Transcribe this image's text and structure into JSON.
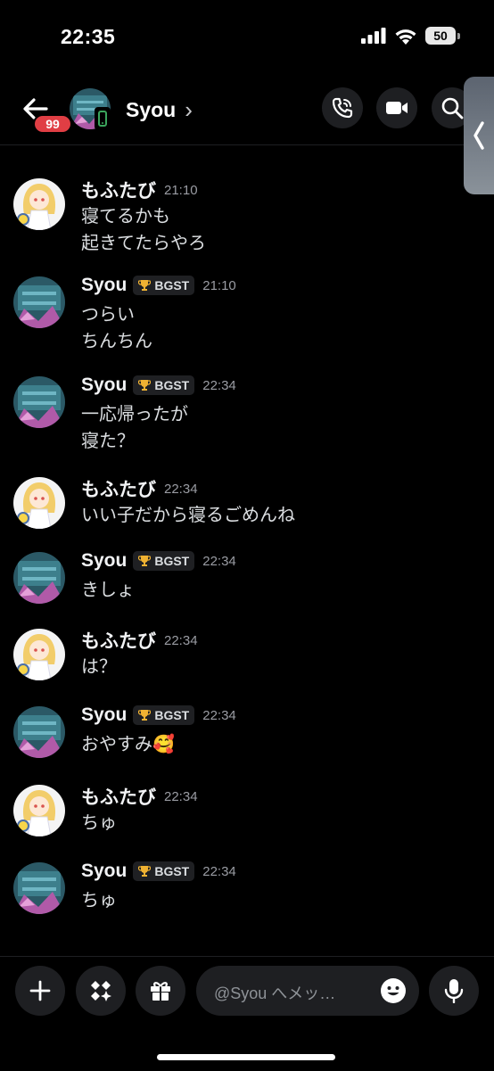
{
  "status_bar": {
    "time": "22:35",
    "battery": "50"
  },
  "header": {
    "unread_count": "99",
    "title": "Syou",
    "chevron": "›",
    "actions": [
      "phone-call-icon",
      "video-camera-icon",
      "search-icon"
    ]
  },
  "messages": [
    {
      "author": "もふたび",
      "time": "21:10",
      "lines": [
        "寝てるかも",
        "起きてたらやろ"
      ],
      "avatar": "mofutabi"
    },
    {
      "author": "Syou",
      "tag": "BGST",
      "time": "21:10",
      "lines": [
        "つらい",
        "ちんちん"
      ],
      "avatar": "syou"
    },
    {
      "author": "Syou",
      "tag": "BGST",
      "time": "22:34",
      "lines": [
        "一応帰ったが",
        "寝た？"
      ],
      "avatar": "syou"
    },
    {
      "author": "もふたび",
      "time": "22:34",
      "lines": [
        "いい子だから寝るごめんね"
      ],
      "avatar": "mofutabi"
    },
    {
      "author": "Syou",
      "tag": "BGST",
      "time": "22:34",
      "lines": [
        "きしょ"
      ],
      "avatar": "syou"
    },
    {
      "author": "もふたび",
      "time": "22:34",
      "lines": [
        "は？"
      ],
      "avatar": "mofutabi"
    },
    {
      "author": "Syou",
      "tag": "BGST",
      "time": "22:34",
      "lines": [
        "おやすみ🥰"
      ],
      "avatar": "syou"
    },
    {
      "author": "もふたび",
      "time": "22:34",
      "lines": [
        "ちゅ"
      ],
      "avatar": "mofutabi"
    },
    {
      "author": "Syou",
      "tag": "BGST",
      "time": "22:34",
      "lines": [
        "ちゅ"
      ],
      "avatar": "syou"
    }
  ],
  "composer": {
    "placeholder": "@Syou へメッ…"
  },
  "colors": {
    "background": "#000000",
    "surface": "#1e1f22",
    "badge": "#e03e44",
    "online_mobile": "#3ba55c",
    "timestamp": "#9a9ca3"
  }
}
